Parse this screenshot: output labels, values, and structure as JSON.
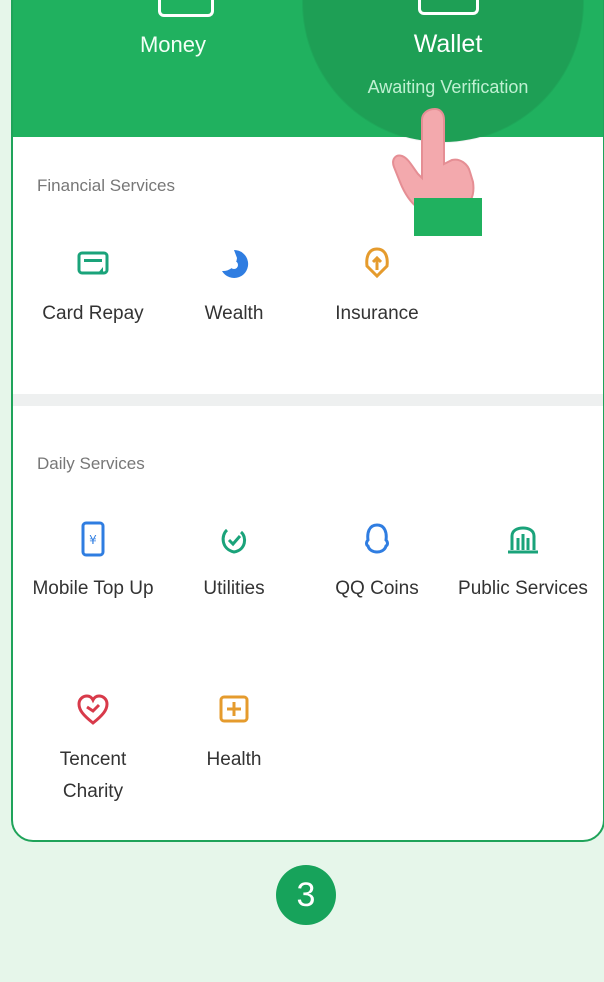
{
  "header": {
    "money_label": "Money",
    "wallet_label": "Wallet",
    "wallet_status": "Awaiting Verification"
  },
  "financial": {
    "title": "Financial Services",
    "items": [
      {
        "label": "Card Repay",
        "icon": "card-icon"
      },
      {
        "label": "Wealth",
        "icon": "wealth-icon"
      },
      {
        "label": "Insurance",
        "icon": "insurance-icon"
      }
    ]
  },
  "daily": {
    "title": "Daily Services",
    "items": [
      {
        "label": "Mobile Top Up",
        "icon": "mobile-icon"
      },
      {
        "label": "Utilities",
        "icon": "utilities-icon"
      },
      {
        "label": "QQ Coins",
        "icon": "qq-icon"
      },
      {
        "label": "Public Services",
        "icon": "public-services-icon"
      },
      {
        "label": "Tencent Charity",
        "icon": "charity-icon"
      },
      {
        "label": "Health",
        "icon": "health-icon"
      }
    ]
  },
  "step_number": "3",
  "colors": {
    "brand_green": "#20b15f",
    "background": "#e6f6ea"
  }
}
